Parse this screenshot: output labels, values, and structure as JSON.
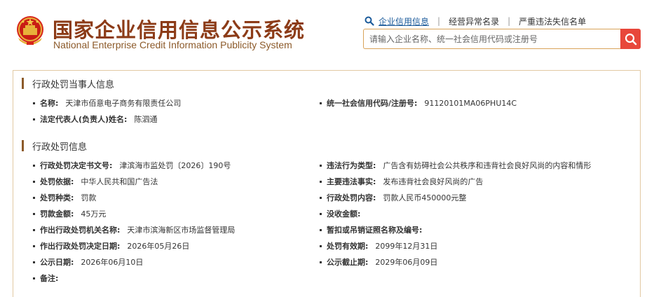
{
  "header": {
    "title_cn": "国家企业信用信息公示系统",
    "title_en": "National Enterprise Credit Information Publicity System"
  },
  "topnav": {
    "items": [
      "企业信用信息",
      "经营异常名录",
      "严重违法失信名单"
    ]
  },
  "search": {
    "placeholder": "请输入企业名称、统一社会信用代码或注册号"
  },
  "sections": {
    "party": {
      "title": "行政处罚当事人信息",
      "name_label": "名称:",
      "name_value": "天津市佰意电子商务有限责任公司",
      "credit_label": "统一社会信用代码/注册号:",
      "credit_value": "91120101MA06PHU14C",
      "rep_label": "法定代表人(负责人)姓名:",
      "rep_value": "陈泗通"
    },
    "penalty": {
      "title": "行政处罚信息",
      "fields": {
        "doc_no": {
          "label": "行政处罚决定书文号:",
          "value": "津滨海市监处罚〔2026〕190号"
        },
        "type": {
          "label": "违法行为类型:",
          "value": "广告含有妨碍社会公共秩序和违背社会良好风尚的内容和情形"
        },
        "basis": {
          "label": "处罚依据:",
          "value": "中华人民共和国广告法"
        },
        "facts": {
          "label": "主要违法事实:",
          "value": "发布违背社会良好风尚的广告"
        },
        "kind": {
          "label": "处罚种类:",
          "value": "罚款"
        },
        "content": {
          "label": "行政处罚内容:",
          "value": "罚款人民币450000元整"
        },
        "amount": {
          "label": "罚款金额:",
          "value": "45万元"
        },
        "confiscation": {
          "label": "没收金额:",
          "value": ""
        },
        "authority": {
          "label": "作出行政处罚机关名称:",
          "value": "天津市滨海新区市场监督管理局"
        },
        "license": {
          "label": "暂扣或吊销证照名称及编号:",
          "value": ""
        },
        "decision_date": {
          "label": "作出行政处罚决定日期:",
          "value": "2026年05月26日"
        },
        "valid_until": {
          "label": "处罚有效期:",
          "value": "2099年12月31日"
        },
        "publish_date": {
          "label": "公示日期:",
          "value": "2026年06月10日"
        },
        "publish_end": {
          "label": "公示截止期:",
          "value": "2029年06月09日"
        },
        "remark": {
          "label": "备注:",
          "value": ""
        }
      }
    }
  },
  "colors": {
    "brand_brown": "#8c3b17",
    "search_button": "#e8473b",
    "link_blue": "#1a5a9a",
    "panel_border": "#e2c9a3"
  }
}
